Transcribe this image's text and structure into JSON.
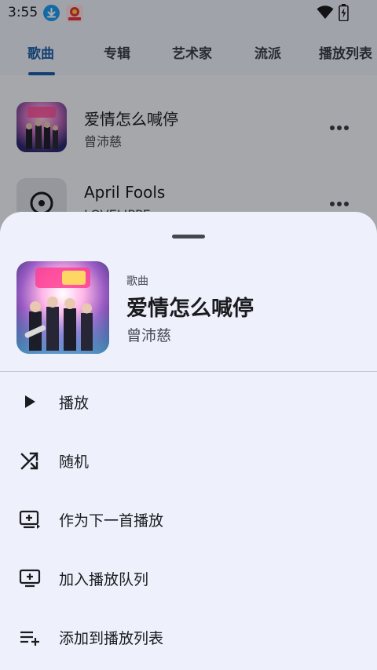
{
  "status_bar": {
    "time": "3:55",
    "icons": [
      "download-notification-icon",
      "app-notification-icon",
      "wifi-icon",
      "battery-icon"
    ]
  },
  "tabs": [
    {
      "label": "歌曲",
      "active": true
    },
    {
      "label": "专辑",
      "active": false
    },
    {
      "label": "艺术家",
      "active": false
    },
    {
      "label": "流派",
      "active": false
    },
    {
      "label": "播放列表",
      "active": false
    }
  ],
  "songs": [
    {
      "title": "爱情怎么喊停",
      "artist": "曾沛慈"
    },
    {
      "title": "April Fools",
      "artist": "LOVELIPPE"
    }
  ],
  "sheet": {
    "type_label": "歌曲",
    "title": "爱情怎么喊停",
    "artist": "曾沛慈",
    "menu": [
      {
        "label": "播放",
        "icon": "play-icon"
      },
      {
        "label": "随机",
        "icon": "shuffle-icon"
      },
      {
        "label": "作为下一首播放",
        "icon": "play-next-icon"
      },
      {
        "label": "加入播放队列",
        "icon": "add-to-queue-icon"
      },
      {
        "label": "添加到播放列表",
        "icon": "add-to-playlist-icon"
      }
    ]
  },
  "colors": {
    "accent": "#1d5fa8",
    "sheet_background": "#eef1fb",
    "scrim": "rgba(0,0,0,0.32)"
  }
}
